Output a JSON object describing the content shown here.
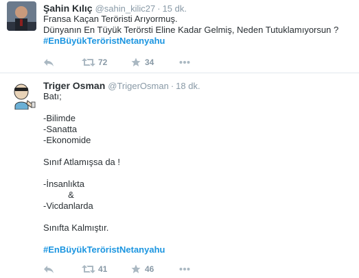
{
  "tweets": [
    {
      "fullname": "Şahin Kılıç",
      "username": "@sahin_kilic27",
      "dot": "·",
      "time": "15 dk.",
      "lines": [
        "Fransa Kaçan Teröristi Arıyormuş.",
        "Dünyanın En Tüyük Terörsti Eline Kadar Gelmiş, Neden Tutuklamıyorsun ?"
      ],
      "hashtag": "#EnBüyükTeröristNetanyahu",
      "retweet_count": "72",
      "favorite_count": "34",
      "icons": {
        "reply": "reply-icon",
        "retweet": "retweet-icon",
        "favorite": "star-icon",
        "more": "more-icon"
      }
    },
    {
      "fullname": "Triger Osman",
      "username": "@TrigerOsman",
      "dot": "·",
      "time": "18 dk.",
      "lines": [
        "Batı;",
        "",
        "-Bilimde",
        "-Sanatta",
        "-Ekonomide",
        "",
        "Sınıf Atlamışsa da !",
        "",
        "-İnsanlıkta",
        "          &",
        "-Vicdanlarda",
        "",
        "Sınıfta Kalmıştır.",
        ""
      ],
      "hashtag": "#EnBüyükTeröristNetanyahu",
      "retweet_count": "41",
      "favorite_count": "46",
      "icons": {
        "reply": "reply-icon",
        "retweet": "retweet-icon",
        "favorite": "star-icon",
        "more": "more-icon"
      }
    }
  ],
  "colors": {
    "link": "#1b95e0",
    "muted": "#8899a6",
    "icon": "#aab8c2",
    "divider": "#e1e8ed"
  }
}
